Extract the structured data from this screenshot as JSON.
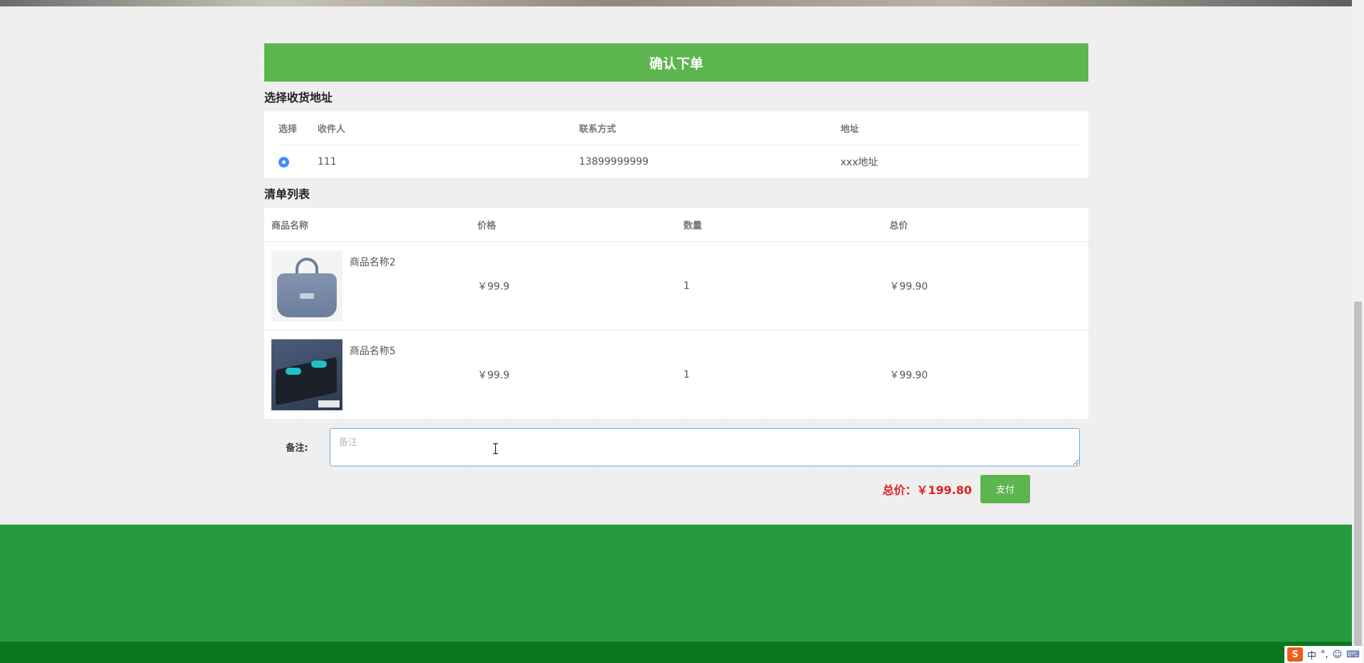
{
  "header": {
    "confirm_title": "确认下单"
  },
  "address_section": {
    "title": "选择收货地址",
    "columns": [
      "选择",
      "收件人",
      "联系方式",
      "地址"
    ],
    "rows": [
      {
        "recipient": "111",
        "phone": "13899999999",
        "address": "xxx地址",
        "selected": true
      }
    ]
  },
  "items_section": {
    "title": "清单列表",
    "columns": [
      "商品名称",
      "价格",
      "数量",
      "总价"
    ],
    "rows": [
      {
        "name": "商品名称2",
        "price": "￥99.9",
        "qty": "1",
        "total": "￥99.90",
        "image": "duffel-bag-image"
      },
      {
        "name": "商品名称5",
        "price": "￥99.9",
        "qty": "1",
        "total": "￥99.90",
        "image": "pushup-board-image"
      }
    ]
  },
  "remark": {
    "label": "备注:",
    "placeholder": "备注",
    "value": ""
  },
  "payment": {
    "total_label": "总价：",
    "total_value": "￥199.80",
    "pay_label": "支付"
  },
  "ime": {
    "logo": "S",
    "lang": "中"
  },
  "colors": {
    "brand_green": "#5cb54e",
    "footer_green": "#259b3e",
    "footer_dark": "#0b761e",
    "total_red": "#e02020"
  }
}
